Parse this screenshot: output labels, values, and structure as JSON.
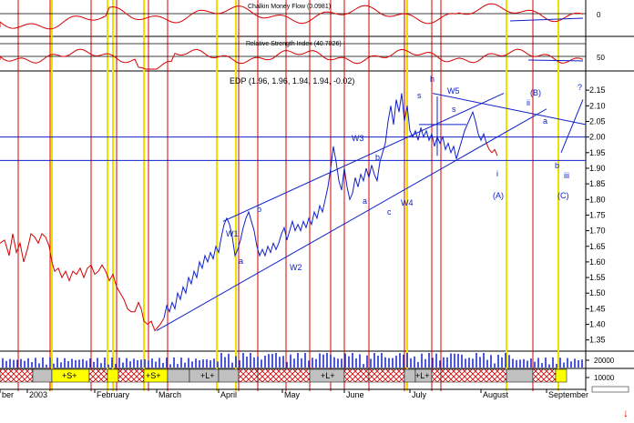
{
  "chart_data": {
    "type": "line",
    "title": "EDP (1.96, 1.96, 1.94, 1.94, -0.02)",
    "price": {
      "x": [
        0,
        1,
        2,
        3,
        4,
        5,
        6,
        7,
        8,
        9,
        10,
        11,
        12,
        13,
        14,
        15,
        16,
        17,
        18,
        19,
        20,
        21,
        22,
        23,
        24,
        25,
        26,
        27,
        28,
        29,
        30,
        31,
        32,
        33,
        34,
        35,
        36,
        37,
        38,
        39,
        40,
        41,
        42,
        43,
        44,
        45,
        46,
        47,
        48,
        49,
        50,
        51,
        52,
        53,
        54,
        55,
        56,
        57,
        58,
        59,
        60,
        61,
        62,
        63,
        64,
        65,
        66,
        67,
        68,
        69,
        70,
        71,
        72,
        73,
        74,
        75,
        76,
        77,
        78,
        79,
        80,
        81,
        82,
        83,
        84,
        85,
        86,
        87,
        88,
        89,
        90,
        91,
        92,
        93,
        94,
        95,
        96,
        97,
        98,
        99,
        100,
        101,
        102,
        103,
        104,
        105,
        106,
        107,
        108,
        109,
        110,
        111,
        112,
        113,
        114,
        115,
        116,
        117,
        118,
        119,
        120,
        121,
        122,
        123,
        124,
        125,
        126,
        127,
        128,
        129,
        130,
        131,
        132,
        133,
        134,
        135,
        136,
        137,
        138,
        139,
        140,
        141,
        142,
        143,
        144,
        145,
        146,
        147,
        148,
        149,
        150,
        151,
        152,
        153,
        154,
        155,
        156,
        157,
        158,
        159,
        160,
        161,
        162,
        163,
        164,
        165,
        166,
        167,
        168,
        169,
        170,
        171,
        172,
        173,
        174,
        175,
        176,
        177,
        178,
        179,
        180,
        181,
        182,
        183,
        184,
        185,
        186,
        187,
        188,
        189,
        190,
        191,
        192,
        193,
        194,
        195,
        196,
        197,
        198,
        199,
        200,
        201,
        202,
        203,
        204,
        205,
        206,
        207,
        208,
        209,
        210,
        211,
        212,
        213,
        214,
        215,
        216,
        217,
        218,
        219,
        220,
        221,
        222,
        223,
        224,
        225,
        226,
        227,
        228,
        229,
        230,
        231,
        232,
        233,
        234,
        235,
        236,
        237,
        238,
        239,
        240,
        241,
        242,
        243,
        244,
        245,
        246,
        247,
        248,
        249,
        250,
        251,
        252,
        253,
        254,
        255,
        256,
        257,
        258,
        259,
        260,
        261,
        262,
        263,
        264,
        265,
        266,
        267,
        268,
        269,
        270,
        271,
        272,
        273,
        274,
        275,
        276,
        277,
        278,
        279,
        280,
        281,
        282,
        283,
        284,
        285,
        286,
        287,
        288,
        289,
        290,
        291,
        292,
        293,
        294,
        295,
        296,
        297,
        298,
        299,
        300,
        301,
        302,
        303,
        304,
        305,
        306,
        307,
        308,
        309,
        310,
        311,
        312,
        313,
        314,
        315,
        316,
        317,
        318,
        319,
        320,
        321,
        322,
        323,
        324,
        325,
        326,
        327,
        328,
        329,
        330,
        331,
        332,
        333,
        334,
        335,
        336,
        337,
        338,
        339,
        340,
        341,
        342,
        343,
        344,
        345,
        346,
        347,
        348,
        349,
        350,
        351,
        352,
        353,
        354,
        355,
        356,
        357,
        358,
        359,
        360,
        361,
        362,
        363,
        364,
        365,
        366,
        367,
        368,
        369,
        370,
        371,
        372,
        373,
        374,
        375,
        376,
        377,
        378,
        379,
        380,
        381,
        382,
        383,
        384,
        385,
        386,
        387,
        388,
        389,
        390,
        391,
        392,
        393,
        394,
        395,
        396,
        397,
        398,
        399,
        400,
        401,
        402,
        403,
        404,
        405,
        406,
        407,
        408,
        409,
        410,
        411,
        412,
        413,
        414,
        415,
        416,
        417,
        418,
        419,
        420,
        421,
        422,
        423,
        424,
        425,
        426,
        427,
        428,
        429,
        430,
        431,
        432,
        433,
        434,
        435,
        436,
        437,
        438,
        439,
        440,
        441,
        442,
        443,
        444,
        445,
        446,
        447,
        448,
        449,
        450,
        451,
        452,
        453,
        454,
        455,
        456,
        457,
        458,
        459,
        460,
        461,
        462,
        463,
        464,
        465,
        466,
        467,
        468,
        469,
        470,
        471,
        472,
        473,
        474,
        475,
        476,
        477,
        478,
        479,
        480,
        481,
        482,
        483,
        484,
        485,
        486,
        487,
        488,
        489,
        490,
        491,
        492,
        493,
        494,
        495,
        496,
        497,
        498,
        499,
        500,
        501,
        502,
        503,
        504,
        505,
        506,
        507,
        508,
        509,
        510,
        511,
        512,
        513,
        514,
        515,
        516,
        517,
        518,
        519,
        520,
        521,
        522,
        523,
        524,
        525,
        526,
        527,
        528,
        529,
        530,
        531,
        532,
        533,
        534,
        535,
        536,
        537,
        538,
        539,
        540,
        541,
        542,
        543,
        544,
        545,
        546,
        547,
        548,
        549,
        550,
        551,
        552,
        553,
        554,
        555,
        556,
        557,
        558,
        559,
        560,
        561,
        562,
        563,
        564,
        565,
        566,
        567,
        568,
        569,
        570,
        571,
        572,
        573,
        574,
        575,
        576,
        577,
        578,
        579,
        580,
        581,
        582,
        583,
        584,
        585,
        586,
        587,
        588,
        589,
        590,
        591,
        592,
        593,
        594,
        595,
        596,
        597,
        598,
        599,
        600,
        601,
        602,
        603,
        604,
        605,
        606,
        607,
        608,
        609,
        610,
        611,
        612,
        613,
        614,
        615,
        616,
        617,
        618,
        619,
        620,
        621,
        622,
        623,
        624,
        625,
        626,
        627,
        628,
        629,
        630,
        631,
        632,
        633,
        634,
        635,
        636,
        637,
        638,
        639,
        640
      ],
      "y_red": [],
      "y_blue": []
    },
    "price_red": [
      [
        0,
        1.66
      ],
      [
        5,
        1.67
      ],
      [
        10,
        1.62
      ],
      [
        14,
        1.69
      ],
      [
        18,
        1.63
      ],
      [
        22,
        1.66
      ],
      [
        26,
        1.6
      ],
      [
        30,
        1.64
      ],
      [
        34,
        1.69
      ],
      [
        38,
        1.68
      ],
      [
        42,
        1.66
      ],
      [
        46,
        1.69
      ],
      [
        50,
        1.68
      ],
      [
        54,
        1.65
      ],
      [
        57,
        1.6
      ],
      [
        60,
        1.57
      ],
      [
        64,
        1.58
      ],
      [
        68,
        1.55
      ],
      [
        72,
        1.57
      ],
      [
        76,
        1.54
      ],
      [
        80,
        1.57
      ],
      [
        84,
        1.56
      ],
      [
        88,
        1.58
      ],
      [
        92,
        1.55
      ],
      [
        96,
        1.58
      ],
      [
        100,
        1.59
      ],
      [
        104,
        1.56
      ],
      [
        108,
        1.57
      ],
      [
        112,
        1.59
      ],
      [
        116,
        1.57
      ],
      [
        120,
        1.54
      ],
      [
        124,
        1.56
      ],
      [
        128,
        1.52
      ],
      [
        132,
        1.5
      ],
      [
        136,
        1.48
      ],
      [
        140,
        1.45
      ],
      [
        144,
        1.44
      ],
      [
        148,
        1.44
      ],
      [
        152,
        1.47
      ],
      [
        155,
        1.45
      ],
      [
        158,
        1.41
      ],
      [
        162,
        1.4
      ],
      [
        166,
        1.41
      ],
      [
        170,
        1.38
      ],
      [
        173,
        1.39
      ],
      [
        176,
        1.4
      ],
      [
        180,
        1.42
      ]
    ],
    "price_blue": [
      [
        180,
        1.42
      ],
      [
        183,
        1.46
      ],
      [
        186,
        1.44
      ],
      [
        189,
        1.47
      ],
      [
        192,
        1.45
      ],
      [
        195,
        1.5
      ],
      [
        198,
        1.48
      ],
      [
        201,
        1.52
      ],
      [
        204,
        1.5
      ],
      [
        207,
        1.55
      ],
      [
        210,
        1.53
      ],
      [
        213,
        1.57
      ],
      [
        216,
        1.55
      ],
      [
        219,
        1.6
      ],
      [
        222,
        1.58
      ],
      [
        225,
        1.62
      ],
      [
        228,
        1.6
      ],
      [
        231,
        1.63
      ],
      [
        234,
        1.61
      ],
      [
        237,
        1.65
      ],
      [
        240,
        1.63
      ],
      [
        243,
        1.68
      ],
      [
        246,
        1.72
      ],
      [
        249,
        1.74
      ],
      [
        252,
        1.72
      ],
      [
        255,
        1.68
      ],
      [
        258,
        1.62
      ],
      [
        261,
        1.64
      ],
      [
        264,
        1.67
      ],
      [
        267,
        1.71
      ],
      [
        270,
        1.74
      ],
      [
        273,
        1.76
      ],
      [
        276,
        1.73
      ],
      [
        279,
        1.7
      ],
      [
        282,
        1.65
      ],
      [
        285,
        1.62
      ],
      [
        288,
        1.64
      ],
      [
        291,
        1.62
      ],
      [
        294,
        1.65
      ],
      [
        297,
        1.63
      ],
      [
        300,
        1.66
      ],
      [
        303,
        1.64
      ],
      [
        306,
        1.66
      ],
      [
        309,
        1.69
      ],
      [
        312,
        1.71
      ],
      [
        315,
        1.67
      ],
      [
        318,
        1.7
      ],
      [
        321,
        1.73
      ],
      [
        324,
        1.7
      ],
      [
        327,
        1.72
      ],
      [
        330,
        1.7
      ],
      [
        333,
        1.73
      ],
      [
        336,
        1.71
      ],
      [
        339,
        1.74
      ],
      [
        342,
        1.72
      ],
      [
        345,
        1.76
      ],
      [
        348,
        1.74
      ],
      [
        351,
        1.78
      ],
      [
        354,
        1.76
      ],
      [
        357,
        1.8
      ],
      [
        360,
        1.84
      ],
      [
        363,
        1.9
      ],
      [
        366,
        1.97
      ],
      [
        369,
        1.92
      ],
      [
        372,
        1.86
      ],
      [
        375,
        1.83
      ],
      [
        378,
        1.9
      ],
      [
        381,
        1.84
      ],
      [
        384,
        1.8
      ],
      [
        387,
        1.82
      ],
      [
        390,
        1.87
      ],
      [
        393,
        1.84
      ],
      [
        396,
        1.88
      ],
      [
        399,
        1.86
      ],
      [
        402,
        1.9
      ],
      [
        405,
        1.87
      ],
      [
        408,
        1.91
      ],
      [
        411,
        1.88
      ],
      [
        414,
        1.86
      ],
      [
        417,
        1.92
      ],
      [
        420,
        1.95
      ],
      [
        423,
        1.98
      ],
      [
        426,
        2.05
      ],
      [
        429,
        2.1
      ],
      [
        432,
        2.04
      ],
      [
        435,
        2.12
      ],
      [
        438,
        2.08
      ],
      [
        441,
        2.14
      ],
      [
        444,
        2.05
      ],
      [
        447,
        2.1
      ],
      [
        450,
        2.02
      ],
      [
        453,
        2.0
      ],
      [
        456,
        2.02
      ],
      [
        459,
        1.99
      ],
      [
        462,
        2.03
      ],
      [
        465,
        2.0
      ],
      [
        468,
        2.02
      ],
      [
        471,
        1.99
      ],
      [
        474,
        2.01
      ],
      [
        477,
        1.97
      ],
      [
        480,
        2.0
      ],
      [
        483,
        1.98
      ],
      [
        486,
        2.0
      ],
      [
        489,
        1.96
      ],
      [
        492,
        1.98
      ],
      [
        495,
        1.95
      ],
      [
        498,
        1.97
      ],
      [
        501,
        1.93
      ],
      [
        504,
        1.96
      ],
      [
        507,
        1.99
      ],
      [
        510,
        2.02
      ],
      [
        513,
        2.04
      ],
      [
        516,
        2.06
      ],
      [
        519,
        2.08
      ],
      [
        522,
        2.05
      ],
      [
        525,
        2.01
      ],
      [
        528,
        1.99
      ],
      [
        531,
        2.01
      ],
      [
        534,
        1.98
      ]
    ],
    "price_red_tail": [
      [
        534,
        1.98
      ],
      [
        537,
        1.96
      ],
      [
        540,
        1.95
      ],
      [
        543,
        1.96
      ],
      [
        546,
        1.94
      ]
    ],
    "yticks": [
      2.15,
      2.1,
      2.05,
      2.0,
      1.95,
      1.9,
      1.85,
      1.8,
      1.75,
      1.7,
      1.65,
      1.6,
      1.55,
      1.5,
      1.45,
      1.4,
      1.35
    ],
    "ylim": [
      1.32,
      2.2
    ],
    "months": [
      "ber",
      "2003",
      "February",
      "March",
      "April",
      "May",
      "June",
      "July",
      "August",
      "September"
    ],
    "cmf": {
      "label": "Chalkin Money Flow (0.0981)",
      "ytick": [
        "0"
      ]
    },
    "rs": {
      "label": "Relative Strength Index (40.7026)",
      "ytick": [
        "50"
      ]
    },
    "volume": {
      "yticks": [
        "20000",
        "10000"
      ]
    },
    "annotations": [
      "W1",
      "b",
      "a",
      "W2",
      "W3",
      "b",
      "a",
      "c",
      "W4",
      "s",
      "h",
      "W5",
      "s",
      "i",
      "(A)",
      "ii",
      "(B)",
      "a",
      "b",
      "iii",
      "(C)",
      "?"
    ],
    "strip_labels": [
      "+S+",
      "+S+",
      "+L+",
      "+L+",
      "+L+"
    ]
  },
  "colors": {
    "red": "#d40000",
    "blue": "#1020c8",
    "yellow": "#f0e000",
    "grid": "#000000"
  }
}
